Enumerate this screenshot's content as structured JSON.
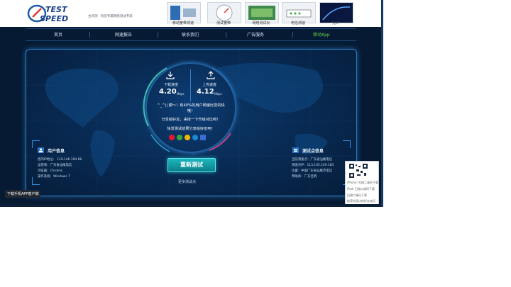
{
  "header": {
    "logo_top": "TEST",
    "logo_bottom": "SPEED",
    "slogan": "台湾测 · 到您专属网络测试专家",
    "thumbs": [
      {
        "label": "移动宽带测速"
      },
      {
        "label": "测试宽带"
      },
      {
        "label": "网络测试仪"
      },
      {
        "label": "电信测速"
      },
      {
        "label": "光纤"
      }
    ]
  },
  "nav": {
    "items": [
      "首页",
      "网速报告",
      "联系我们",
      "广告服务",
      "移动App"
    ],
    "active_index": 4
  },
  "speed": {
    "download_label": "下载速度",
    "download_value": "4.20",
    "download_unit": "Mbps",
    "upload_label": "上传速度",
    "upload_value": "4.12",
    "upload_unit": "Mbps"
  },
  "result": {
    "line1": "^_^|| 额～！有40%的用户网速比您的快",
    "line2": "哦！",
    "line3": "分享给好友，来挂一下升级对比吧！",
    "line4": "快发测试结果分享给好友吧！"
  },
  "share_colors": [
    "#e6162d",
    "#3aa73a",
    "#f2b705",
    "#1a8ad4",
    "#3b6bd6"
  ],
  "retest_label": "重新测试",
  "more_label": "更多测试点",
  "user_info": {
    "title": "用户信息",
    "lines": [
      "您的IP地址： 119.146.194.68",
      "运营商：广东省汕尾电信",
      "浏览器：Chrome",
      "操作系统：Windows 7"
    ]
  },
  "test_info": {
    "title": "测试点信息",
    "lines": [
      "当前测速点：广东省汕尾电信",
      "测速点IP：113.105.159.183",
      "位置：中国广东省汕尾市电信",
      "赞助商：广东佳明"
    ]
  },
  "qr": {
    "lines": [
      "iPhone: 扫描二维码下载",
      "iPad: 扫描二维码下载",
      "扫描二维码下载",
      "推荐给身边的好友来玩"
    ]
  },
  "download_app": "下载手机APP客户端"
}
